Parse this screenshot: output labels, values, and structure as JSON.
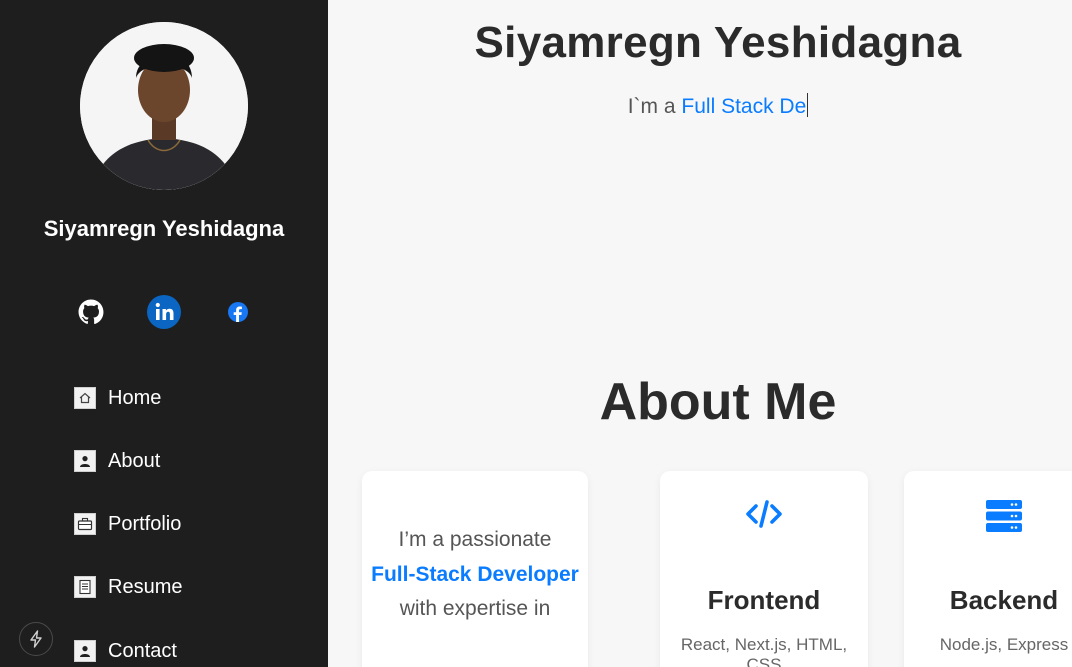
{
  "sidebar": {
    "name": "Siyamregn Yeshidagna",
    "socials": [
      {
        "icon": "github-icon"
      },
      {
        "icon": "linkedin-icon"
      },
      {
        "icon": "facebook-icon"
      }
    ],
    "nav": [
      {
        "label": "Home",
        "icon": "home-icon"
      },
      {
        "label": "About",
        "icon": "user-icon"
      },
      {
        "label": "Portfolio",
        "icon": "briefcase-icon"
      },
      {
        "label": "Resume",
        "icon": "document-icon"
      },
      {
        "label": "Contact",
        "icon": "contact-icon"
      }
    ],
    "bolt_icon": "lightning-icon"
  },
  "hero": {
    "title": "Siyamregn Yeshidagna",
    "typed_prefix": "I`m a ",
    "typed_text": "Full Stack De"
  },
  "about": {
    "title": "About Me",
    "intro": {
      "before": "I’m a passionate",
      "highlight": "Full-Stack Developer",
      "after": "with expertise in"
    },
    "cards": [
      {
        "title": "Frontend",
        "text": "React, Next.js, HTML, CSS",
        "icon": "code-icon"
      },
      {
        "title": "Backend",
        "text": "Node.js, Express",
        "icon": "server-icon"
      }
    ]
  },
  "colors": {
    "sidebar_bg": "#1e1e1e",
    "accent": "#0a7cff",
    "page_bg": "#f7f7f7"
  }
}
